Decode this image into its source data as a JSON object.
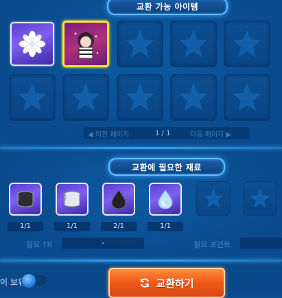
{
  "colors": {
    "accent_blue": "#5cc2ff",
    "button_orange": "#ef5a17",
    "highlight_yellow": "#ffe530"
  },
  "exchange_section": {
    "title": "교환 가능 아이템",
    "items": [
      {
        "name": "flower-item",
        "icon": "white-flower-icon",
        "selected": false
      },
      {
        "name": "character-item",
        "icon": "character-portrait-icon",
        "selected": true
      }
    ],
    "empty_slot_icon": "star-icon",
    "pager": {
      "prev": "◀ 이전 페이지",
      "page": "1 / 1",
      "next": "다음 페이지 ▶"
    }
  },
  "materials_section": {
    "title": "교환에 필요한 재료",
    "materials": [
      {
        "icon": "dark-cloth-icon",
        "count": "1/1"
      },
      {
        "icon": "white-cloth-icon",
        "count": "1/1"
      },
      {
        "icon": "black-drop-icon",
        "count": "2/1"
      },
      {
        "icon": "blue-drop-icon",
        "count": "1/1"
      }
    ],
    "required_tr_label": "필요 TR",
    "required_tr_value": "-",
    "required_point_label": "필요 포인트"
  },
  "footer": {
    "toggle_label": "이 보유",
    "exchange_button": "교환하기"
  }
}
